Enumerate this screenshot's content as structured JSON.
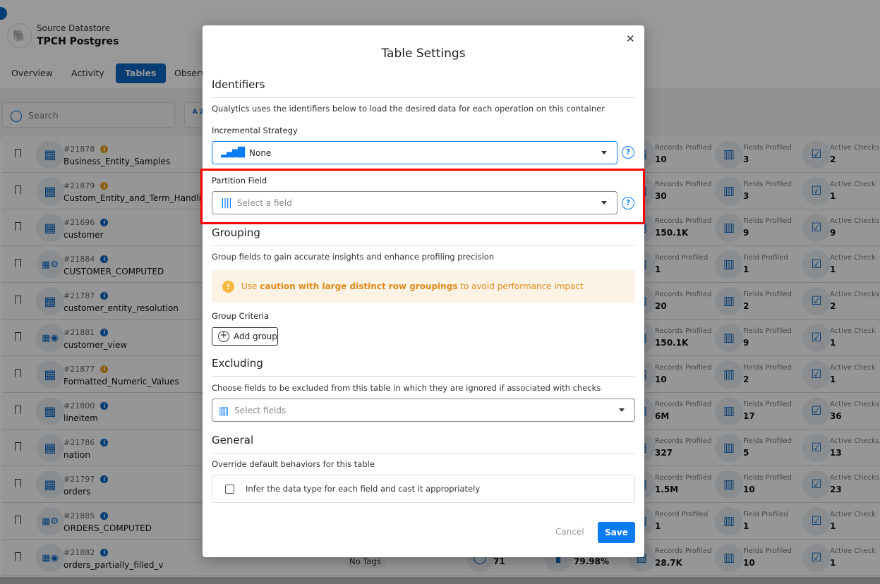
{
  "header": {
    "subtitle": "Source Datastore",
    "title": "TPCH Postgres"
  },
  "tabs": [
    {
      "label": "Overview"
    },
    {
      "label": "Activity"
    },
    {
      "label": "Tables",
      "active": true
    },
    {
      "label": "Observability"
    }
  ],
  "search": {
    "placeholder": "Search"
  },
  "sort_icon_text": "A Z",
  "rows": [
    {
      "id": "#21878",
      "name": "Business_Entity_Samples",
      "info": "#e8a020",
      "type": "table",
      "rec_label": "Records Profiled",
      "rec": "10",
      "fld_label": "Fields Profiled",
      "fld": "3",
      "chk_label": "Active Checks",
      "chk": "2"
    },
    {
      "id": "#21879",
      "name": "Custom_Entity_and_Term_Handling",
      "info": "#e8a020",
      "type": "table",
      "rec_label": "Records Profiled",
      "rec": "30",
      "fld_label": "Fields Profiled",
      "fld": "3",
      "chk_label": "Active Check",
      "chk": "1"
    },
    {
      "id": "#21696",
      "name": "customer",
      "info": "#0a66c2",
      "type": "table",
      "rec_label": "Records Profiled",
      "rec": "150.1K",
      "fld_label": "Fields Profiled",
      "fld": "9",
      "chk_label": "Active Checks",
      "chk": "9"
    },
    {
      "id": "#21884",
      "name": "CUSTOMER_COMPUTED",
      "info": "#0a66c2",
      "type": "computed",
      "rec_label": "Record Profiled",
      "rec": "1",
      "fld_label": "Field Profiled",
      "fld": "1",
      "chk_label": "Active Check",
      "chk": "1"
    },
    {
      "id": "#21787",
      "name": "customer_entity_resolution",
      "info": "#0a66c2",
      "type": "table",
      "rec_label": "Records Profiled",
      "rec": "20",
      "fld_label": "Fields Profiled",
      "fld": "2",
      "chk_label": "Active Checks",
      "chk": "2"
    },
    {
      "id": "#21881",
      "name": "customer_view",
      "info": "#0a66c2",
      "type": "view",
      "rec_label": "Records Profiled",
      "rec": "150.1K",
      "fld_label": "Fields Profiled",
      "fld": "9",
      "chk_label": "Active Check",
      "chk": "1"
    },
    {
      "id": "#21877",
      "name": "Formatted_Numeric_Values",
      "info": "#e8a020",
      "type": "table",
      "rec_label": "Records Profiled",
      "rec": "10",
      "fld_label": "Fields Profiled",
      "fld": "2",
      "chk_label": "Active Check",
      "chk": "1"
    },
    {
      "id": "#21800",
      "name": "lineitem",
      "info": "#0a66c2",
      "type": "table",
      "rec_label": "Records Profiled",
      "rec": "6M",
      "fld_label": "Fields Profiled",
      "fld": "17",
      "chk_label": "Active Checks",
      "chk": "36"
    },
    {
      "id": "#21786",
      "name": "nation",
      "info": "#0a66c2",
      "type": "table",
      "rec_label": "Records Profiled",
      "rec": "327",
      "fld_label": "Fields Profiled",
      "fld": "5",
      "chk_label": "Active Checks",
      "chk": "13"
    },
    {
      "id": "#21797",
      "name": "orders",
      "info": "#0a66c2",
      "type": "table",
      "rec_label": "Records Profiled",
      "rec": "1.5M",
      "fld_label": "Fields Profiled",
      "fld": "10",
      "chk_label": "Active Checks",
      "chk": "23"
    },
    {
      "id": "#21885",
      "name": "ORDERS_COMPUTED",
      "info": "#0a66c2",
      "type": "computed",
      "rec_label": "Record Profiled",
      "rec": "1",
      "fld_label": "Field Profiled",
      "fld": "1",
      "chk_label": "Active Check",
      "chk": "1"
    },
    {
      "id": "#21882",
      "name": "orders_partially_filled_v",
      "info": "#0a66c2",
      "type": "view",
      "tags": "No Tags",
      "extra1": "71",
      "extra2": "79.98%",
      "rec_label": "Records Profiled",
      "rec": "28.7K",
      "fld_label": "Fields Profiled",
      "fld": "10",
      "chk_label": "Active Check",
      "chk": "1"
    }
  ],
  "modal": {
    "title": "Table Settings",
    "identifiers": {
      "heading": "Identifiers",
      "desc": "Qualytics uses the identifiers below to load the desired data for each operation on this container",
      "incremental_label": "Incremental Strategy",
      "incremental_value": "None",
      "partition_label": "Partition Field",
      "partition_placeholder": "Select a field"
    },
    "grouping": {
      "heading": "Grouping",
      "desc": "Group fields to gain accurate insights and enhance profiling precision",
      "warn_pre": "Use ",
      "warn_bold": "caution with large distinct row groupings",
      "warn_post": " to avoid performance impact",
      "criteria_label": "Group Criteria",
      "add_label": "Add group"
    },
    "excluding": {
      "heading": "Excluding",
      "desc": "Choose fields to be excluded from this table in which they are ignored if associated with checks",
      "placeholder": "Select fields"
    },
    "general": {
      "heading": "General",
      "desc": "Override default behaviors for this table",
      "checkbox_label": "Infer the data type for each field and cast it appropriately",
      "checked": false
    },
    "cancel_label": "Cancel",
    "save_label": "Save"
  },
  "colors": {
    "accent": "#0a7cf2",
    "brand": "#0a66c2",
    "highlight": "#ff0000",
    "warning": "#e08a1a"
  }
}
